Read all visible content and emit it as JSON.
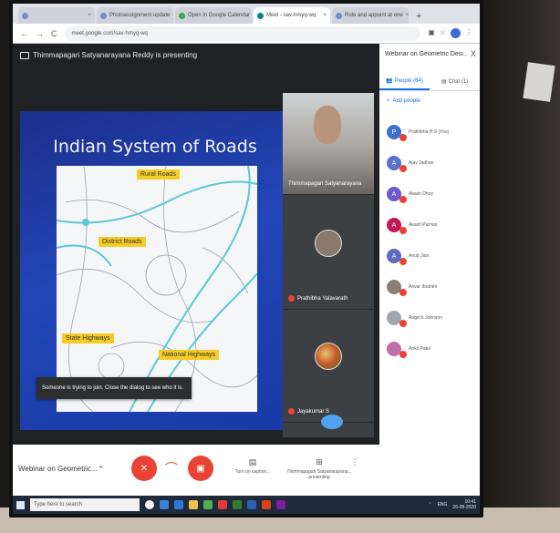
{
  "browser": {
    "tabs": [
      {
        "label": "",
        "active": false
      },
      {
        "label": "Photoassignment update",
        "active": false
      },
      {
        "label": "Open in Google Calendar",
        "active": false
      },
      {
        "label": "Meet - sav-hmyq-wq",
        "active": true
      },
      {
        "label": "Role and appoint at one",
        "active": false
      }
    ],
    "new_tab_glyph": "+",
    "url": "meet.google.com/sav-hmyq-wq",
    "nav": {
      "back": "←",
      "forward": "→",
      "reload": "C"
    }
  },
  "meet": {
    "presenting_text": "Thimmapagari Satyanarayana Reddy is presenting",
    "slide": {
      "title": "Indian System of Roads",
      "labels": [
        "Rural Roads",
        "District Roads",
        "State Highways",
        "National Highways"
      ]
    },
    "toast": "Someone is trying to join. Close the dialog to see who it is.",
    "tiles": [
      {
        "name": "Thimmapagari Satyanarayana"
      },
      {
        "name": "Prathibha Yalavarath"
      },
      {
        "name": "Jayakumar S"
      }
    ]
  },
  "panel": {
    "title": "Webinar on Geometric Desi...",
    "close": "X",
    "tabs": [
      {
        "label": "People (64)",
        "active": true
      },
      {
        "label": "Chat (1)",
        "active": false
      }
    ],
    "add_people": "Add people",
    "people": [
      {
        "initial": "P",
        "color": "#3b6fd4",
        "name": "Prathibha H S (You)"
      },
      {
        "initial": "A",
        "color": "#5b6fd0",
        "name": "Ajay Jadhav"
      },
      {
        "initial": "A",
        "color": "#6a5acd",
        "name": "Akash Dhoy"
      },
      {
        "initial": "A",
        "color": "#c2185b",
        "name": "Akash Parmar"
      },
      {
        "initial": "A",
        "color": "#5c6bc0",
        "name": "Anup Jain"
      },
      {
        "initial": "",
        "color": "#8a7f78",
        "name": "Anvar Ibrahim"
      },
      {
        "initial": "",
        "color": "#9fa6ad",
        "name": "Angel k Johnson"
      },
      {
        "initial": "",
        "color": "#c06fa8",
        "name": "Ankit Patel"
      }
    ]
  },
  "callbar": {
    "meeting_name": "Webinar on Geometric...",
    "chevron": "^",
    "turn_on_captions": "Turn on caption...",
    "presenting_label": "Thimmapagari Satyanarayana... presenting",
    "more": "⋮"
  },
  "taskbar": {
    "search_placeholder": "Type here to search",
    "tray_lang": "ENG",
    "time": "10:41",
    "date": "26-08-2020"
  }
}
